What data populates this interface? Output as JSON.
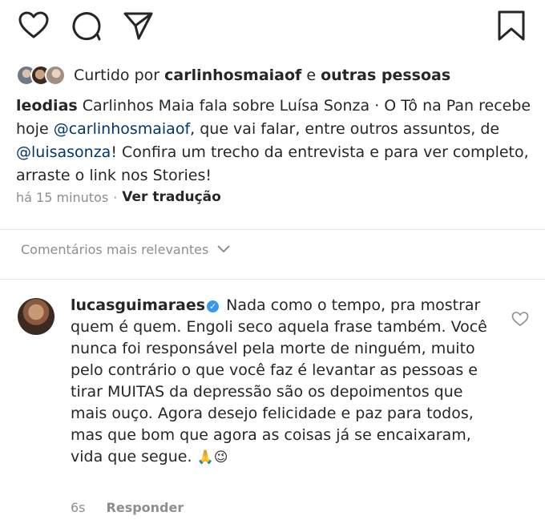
{
  "actions": {
    "icons": [
      "heart-icon",
      "comment-icon",
      "share-icon",
      "bookmark-icon"
    ]
  },
  "likes": {
    "prefix": "Curtido por",
    "user": "carlinhosmaiaof",
    "joiner": "e",
    "others": "outras pessoas"
  },
  "caption": {
    "username": "leodias",
    "text_1": "Carlinhos Maia fala sobre Luísa Sonza · O Tô na Pan recebe hoje",
    "mention_1": "@carlinhosmaiaof",
    "text_2": ", que vai falar, entre outros assuntos, de",
    "mention_2": "@luisasonza",
    "text_3": "! Confira um trecho da entrevista e para ver completo, arraste o link nos Stories!"
  },
  "meta": {
    "time": "há 15 minutos",
    "separator": "·",
    "translate": "Ver tradução"
  },
  "comments_header": {
    "label": "Comentários mais relevantes"
  },
  "comment": {
    "username": "lucasguimaraes",
    "text": "Nada como o tempo, pra mostrar quem é quem. Engoli seco aquela frase também. Você nunca foi responsável pela morte de ninguém, muito pelo contrário o que você faz é levantar as pessoas e tirar MUITAS da depressão são os depoimentos que mais ouço. Agora desejo felicidade e paz para todos, mas que bom que agora as coisas já se encaixaram, vida que segue.",
    "emojis": "🙏😉",
    "time": "6s",
    "reply": "Responder"
  },
  "colors": {
    "mention": "#00376b",
    "muted": "#8e8e8e",
    "verified": "#3897f0",
    "text": "#262626"
  }
}
